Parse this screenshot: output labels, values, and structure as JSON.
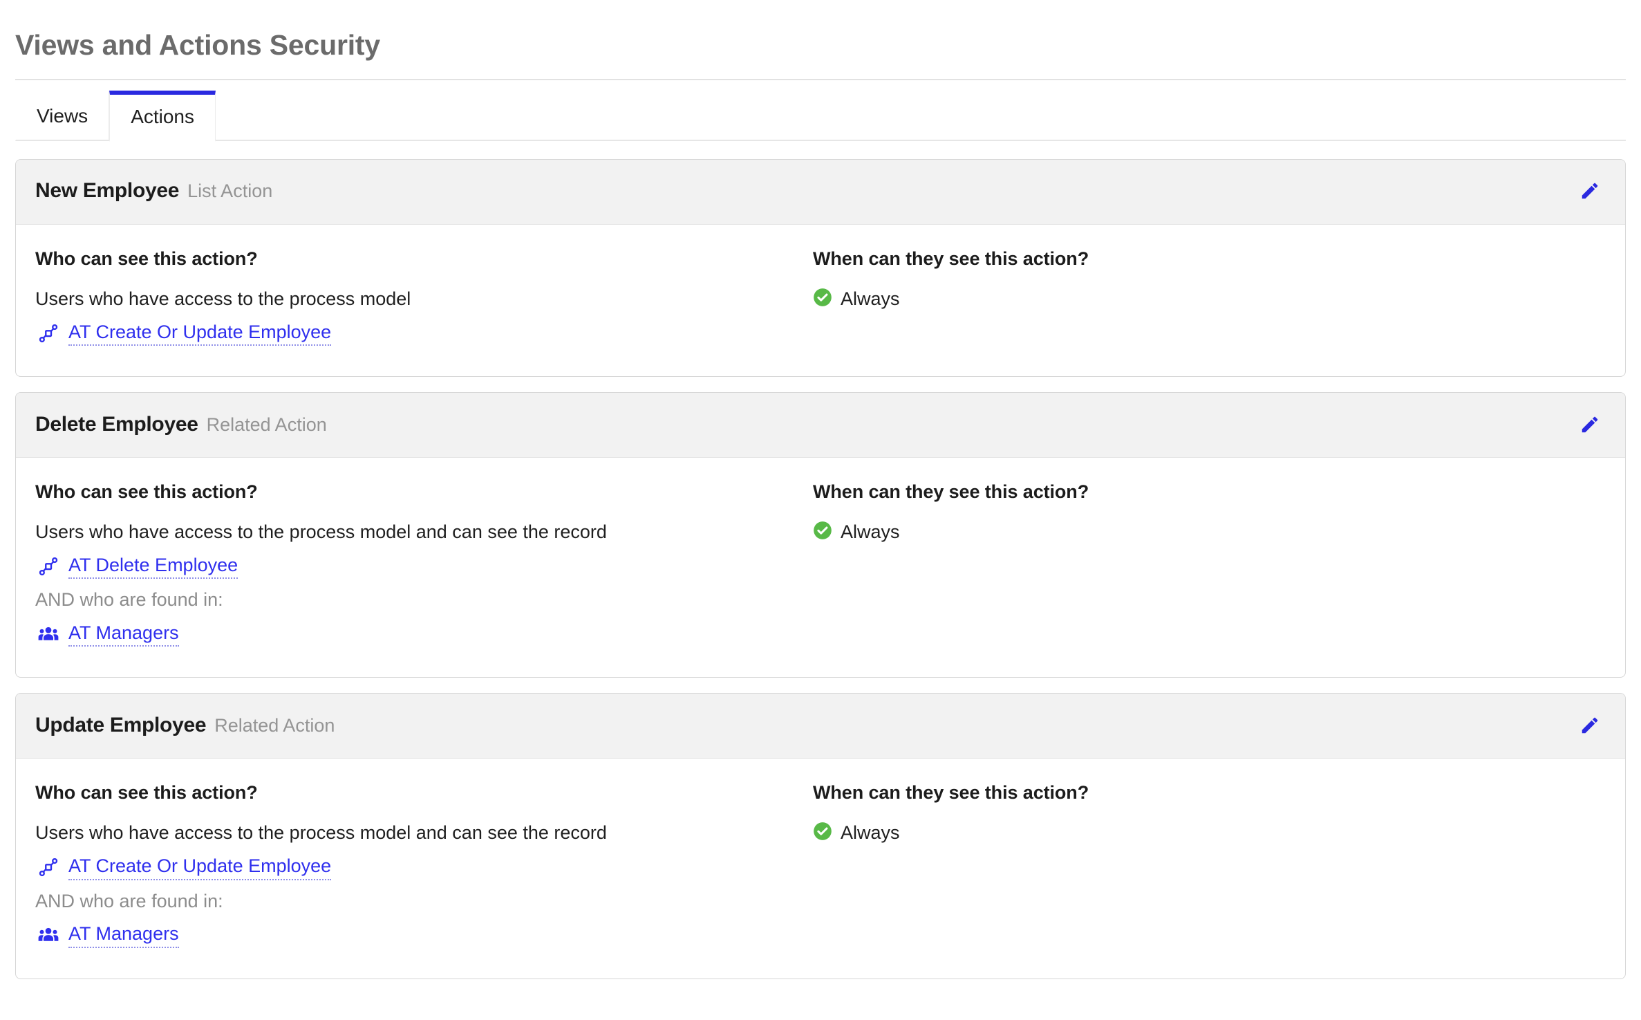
{
  "page": {
    "title": "Views and Actions Security"
  },
  "tabs": [
    {
      "label": "Views",
      "active": false
    },
    {
      "label": "Actions",
      "active": true
    }
  ],
  "labels": {
    "who_heading": "Who can see this action?",
    "when_heading": "When can they see this action?",
    "and_found_in": "AND who are found in:",
    "edit_icon": "pencil-icon",
    "always_icon": "check-circle-icon",
    "process_model_icon": "process-model-icon",
    "group_icon": "user-group-icon"
  },
  "colors": {
    "accent_blue": "#2a29e0",
    "link_blue": "#2f2fee",
    "status_green": "#58b947",
    "title_gray": "#6b6b6b",
    "muted_gray": "#8c8c8c",
    "card_header_bg": "#f2f2f2",
    "card_border": "#d6d6d6"
  },
  "cards": [
    {
      "title": "New Employee",
      "subtitle": "List Action",
      "who": {
        "heading": "Who can see this action?",
        "description": "Users who have access to the process model",
        "references": [
          {
            "icon": "process-model-icon",
            "label": "AT Create Or Update Employee"
          }
        ],
        "and_label": "",
        "and_references": []
      },
      "when": {
        "heading": "When can they see this action?",
        "value": "Always"
      }
    },
    {
      "title": "Delete Employee",
      "subtitle": "Related Action",
      "who": {
        "heading": "Who can see this action?",
        "description": "Users who have access to the process model and can see the record",
        "references": [
          {
            "icon": "process-model-icon",
            "label": "AT Delete Employee"
          }
        ],
        "and_label": "AND who are found in:",
        "and_references": [
          {
            "icon": "user-group-icon",
            "label": "AT Managers"
          }
        ]
      },
      "when": {
        "heading": "When can they see this action?",
        "value": "Always"
      }
    },
    {
      "title": "Update Employee",
      "subtitle": "Related Action",
      "who": {
        "heading": "Who can see this action?",
        "description": "Users who have access to the process model and can see the record",
        "references": [
          {
            "icon": "process-model-icon",
            "label": "AT Create Or Update Employee"
          }
        ],
        "and_label": "AND who are found in:",
        "and_references": [
          {
            "icon": "user-group-icon",
            "label": "AT Managers"
          }
        ]
      },
      "when": {
        "heading": "When can they see this action?",
        "value": "Always"
      }
    }
  ]
}
